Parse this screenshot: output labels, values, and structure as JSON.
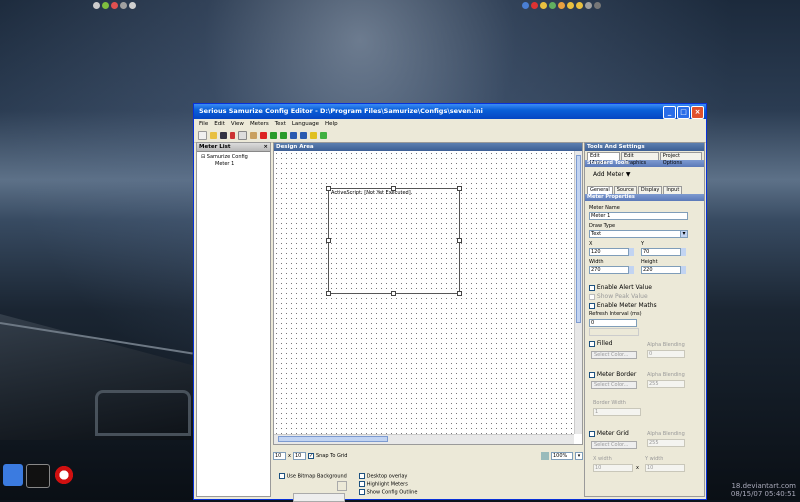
{
  "window": {
    "title": "Serious Samurize Config Editor - D:\\Program Files\\Samurize\\Configs\\seven.ini"
  },
  "menu": [
    "File",
    "Edit",
    "View",
    "Meters",
    "Text",
    "Language",
    "Help"
  ],
  "meter_list": {
    "header": "Meter List",
    "close": "×",
    "tree_root": "Samurize Config",
    "tree_child": "Meter 1"
  },
  "design_area": {
    "header": "Design Area",
    "meter_text": "ActiveScript: [Not Yet Executed]"
  },
  "bottom_bar": {
    "grid_x": "10",
    "times": "x",
    "grid_y": "10",
    "snap_label": "Snap To Grid",
    "zoom": "100%"
  },
  "options": {
    "use_bitmap_bg": "Use Bitmap Background",
    "desktop_overlay": "Desktop overlay",
    "highlight_meters": "Highlight Meters",
    "show_config_outline": "Show Config Outline"
  },
  "tools": {
    "header": "Tools And Settings",
    "tabs": [
      "Edit Meters",
      "Edit Graphics",
      "Project Options"
    ],
    "standard_tools": "Standard Tools",
    "add_meter": "Add Meter",
    "sub_tabs": [
      "General",
      "Source",
      "Display",
      "Input"
    ],
    "meter_properties": "Meter Properties",
    "meter_name_label": "Meter Name",
    "meter_name": "Meter 1",
    "draw_type_label": "Draw Type",
    "draw_type": "Text",
    "x_label": "X",
    "x_value": "120",
    "y_label": "Y",
    "y_value": "70",
    "width_label": "Width",
    "width_value": "270",
    "height_label": "Height",
    "height_value": "220",
    "enable_alert": "Enable Alert Value",
    "show_peak": "Show Peak Value",
    "enable_maths": "Enable Meter Maths",
    "refresh_label": "Refresh Interval (ms)",
    "refresh_value": "0",
    "filled": "Filled",
    "select_color": "Select Color...",
    "alpha_blending": "Alpha Blending",
    "alpha_filled": "0",
    "meter_border": "Meter Border",
    "alpha_border": "255",
    "border_width_label": "Border Width",
    "border_width": "1",
    "meter_grid": "Meter Grid",
    "alpha_grid": "255",
    "x_width_label": "X width",
    "x_width": "10",
    "y_width_label": "Y width",
    "y_width": "10",
    "x_sep": "x"
  },
  "taskbar_watermark": {
    "line1": "18.deviantart.com",
    "line2": "08/15/07 05:40:51"
  }
}
